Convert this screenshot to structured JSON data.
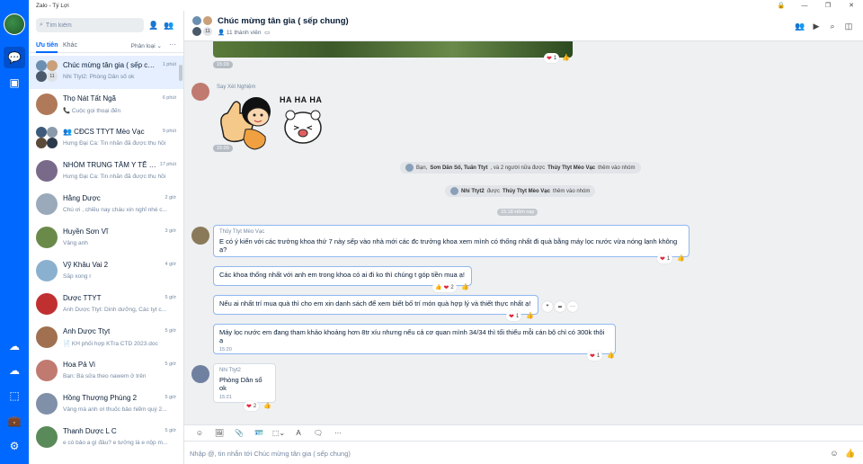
{
  "window": {
    "title": "Zalo - Tý Lợi"
  },
  "search": {
    "placeholder": "Tìm kiếm"
  },
  "tabs": {
    "priority": "Ưu tiên",
    "other": "Khác",
    "classify": "Phân loại",
    "more": "···"
  },
  "conversations": [
    {
      "name": "Chúc mừng tân gia ( sếp chung)",
      "time": "1 phút",
      "preview": "Nhi Ttyt2: Phòng Dân số ok",
      "badge": "11",
      "selected": true
    },
    {
      "name": "Thọ Nát Tất Ngã",
      "time": "6 phút",
      "preview": "📞 Cuộc gọi thoại đến"
    },
    {
      "name": "👥 CĐCS TTYT Mèo Vạc",
      "time": "9 phút",
      "preview": "Hưng Đại Ca: Tin nhắn đã được thu hồi"
    },
    {
      "name": "NHÓM TRUNG TÂM Y TẾ H...",
      "time": "17 phút",
      "preview": "Hưng Đại Ca: Tin nhắn đã được thu hồi"
    },
    {
      "name": "Hằng Dược",
      "time": "2 giờ",
      "preview": "Chú ơi , chiều nay cháu xin nghỉ nhé c..."
    },
    {
      "name": "Huyền Sơn Vĩ",
      "time": "3 giờ",
      "preview": "Vâng anh"
    },
    {
      "name": "Vỹ Khâu Vai 2",
      "time": "4 giờ",
      "preview": "Sắp xong r"
    },
    {
      "name": "Dược TTYT",
      "time": "5 giờ",
      "preview": "Anh Dược Ttyt: Dinh dưỡng, Các tyt c..."
    },
    {
      "name": "Anh Dược Ttyt",
      "time": "5 giờ",
      "preview": "📄 KH phối hợp KTra CTD 2023.doc"
    },
    {
      "name": "Hoa Pả Vi",
      "time": "5 giờ",
      "preview": "Bạn: Bà sửa theo nawem ở trên"
    },
    {
      "name": "Hồng Thượng Phùng 2",
      "time": "5 giờ",
      "preview": "Vâng mà anh ơi thuốc bảo hiểm quý 2..."
    },
    {
      "name": "Thanh Dược L C",
      "time": "5 giờ",
      "preview": "e có bảo a gì đâu? e tưởng là e nộp m..."
    }
  ],
  "chat": {
    "title": "Chúc mừng tân gia ( sếp chung)",
    "members": "11 thành viên",
    "composer_placeholder": "Nhập @, tin nhắn tới Chúc mừng tân gia ( sếp chung)",
    "msgs": {
      "img_time": "15:09",
      "img_react": "1",
      "sticker_sender": "Say Xét Nghiệm",
      "sticker_text": "HA HA HA",
      "sticker_time": "15:09",
      "sys1_pre": "Bạn, ",
      "sys1_names": "Sơn Dân Số, Tuấn Ttyt",
      "sys1_mid": ", và 2 người nữa được ",
      "sys1_by": "Thủy Ttyt Mèo Vạc",
      "sys1_post": " thêm vào nhóm",
      "sys2_name": "Nhi Ttyt2",
      "sys2_mid": " được ",
      "sys2_by": "Thủy Ttyt Mèo Vạc",
      "sys2_post": " thêm vào nhóm",
      "divider": "15:18 Hôm nay",
      "thuy_name": "Thủy Ttyt Mèo Vạc",
      "m1": "E có ý kiến với các trưởng khoa thứ 7 này sếp vào nhà mới các đc trưởng khoa xem mình có thống nhất đi quà bằng máy lọc nước vừa nóng lạnh không ạ?",
      "m1_react": "1",
      "m2": "Các khoa thống nhất với anh em trong khoa có ai đi ko thì chúng t góp tiền mua ạ!",
      "m2_react": "2",
      "m3": "Nếu ai nhất trí mua quà thì cho em xin danh sách để xem biết bố trí món quà hợp lý và thiết thực nhất ạ!",
      "m3_react": "1",
      "m4": "Máy lọc nước em đang tham khảo khoảng hơn 8tr xíu nhưng nếu cả cơ quan mình 34/34 thì tối thiểu mỗi cán bộ chỉ có 300k thôi ạ",
      "m4_time": "15:20",
      "m4_react": "1",
      "nhi_name": "Nhi Ttyt2",
      "m5": "Phòng Dân số ok",
      "m5_time": "15:21",
      "m5_react": "2"
    }
  }
}
